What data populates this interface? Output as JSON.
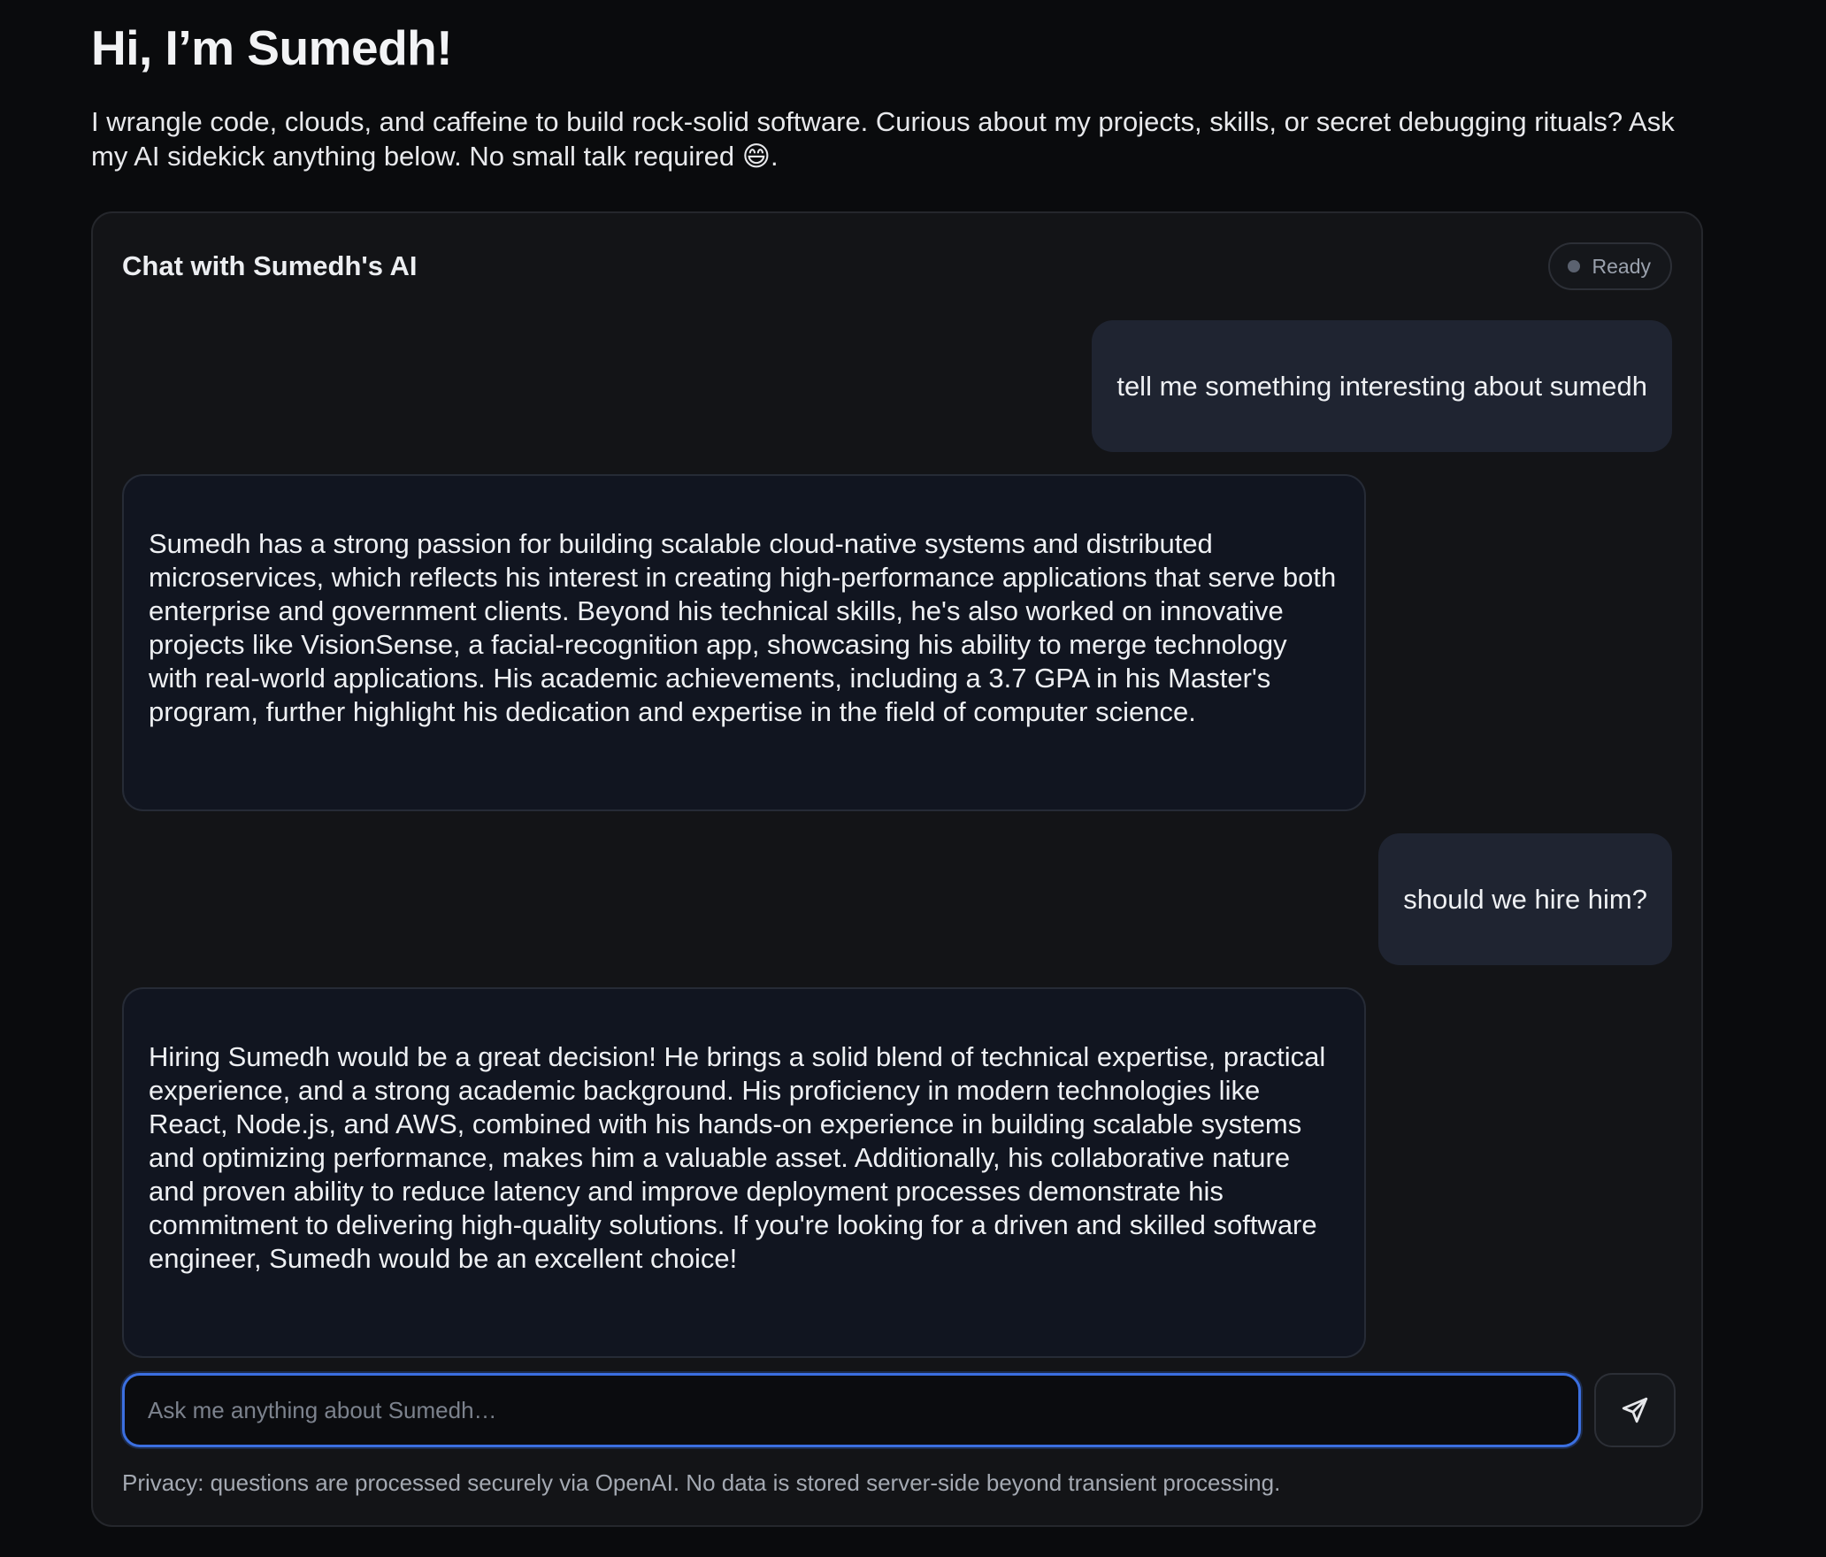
{
  "hero": {
    "title": "Hi, I’m Sumedh!",
    "intro": "I wrangle code, clouds, and caffeine to build rock-solid software. Curious about my projects, skills, or secret debugging rituals? Ask my AI sidekick anything below. No small talk required 😄."
  },
  "chat": {
    "title": "Chat with Sumedh's AI",
    "status": "Ready",
    "messages": [
      {
        "role": "user",
        "text": "tell me something interesting about sumedh"
      },
      {
        "role": "assistant",
        "text": "Sumedh has a strong passion for building scalable cloud-native systems and distributed microservices, which reflects his interest in creating high-performance applications that serve both enterprise and government clients. Beyond his technical skills, he's also worked on innovative projects like VisionSense, a facial-recognition app, showcasing his ability to merge technology with real-world applications. His academic achievements, including a 3.7 GPA in his Master's program, further highlight his dedication and expertise in the field of computer science."
      },
      {
        "role": "user",
        "text": "should we hire him?"
      },
      {
        "role": "assistant",
        "text": "Hiring Sumedh would be a great decision! He brings a solid blend of technical expertise, practical experience, and a strong academic background. His proficiency in modern technologies like React, Node.js, and AWS, combined with his hands-on experience in building scalable systems and optimizing performance, makes him a valuable asset. Additionally, his collaborative nature and proven ability to reduce latency and improve deployment processes demonstrate his commitment to delivering high-quality solutions. If you're looking for a driven and skilled software engineer, Sumedh would be an excellent choice!"
      }
    ],
    "input": {
      "value": "",
      "placeholder": "Ask me anything about Sumedh…"
    },
    "send_icon": "send-icon",
    "privacy": "Privacy: questions are processed securely via OpenAI. No data is stored server-side beyond transient processing."
  },
  "colors": {
    "background": "#0a0b0d",
    "card": "#131417",
    "user_bubble": "#1f2431",
    "assistant_bubble": "#111520",
    "input_focus": "#3b6fe0"
  }
}
